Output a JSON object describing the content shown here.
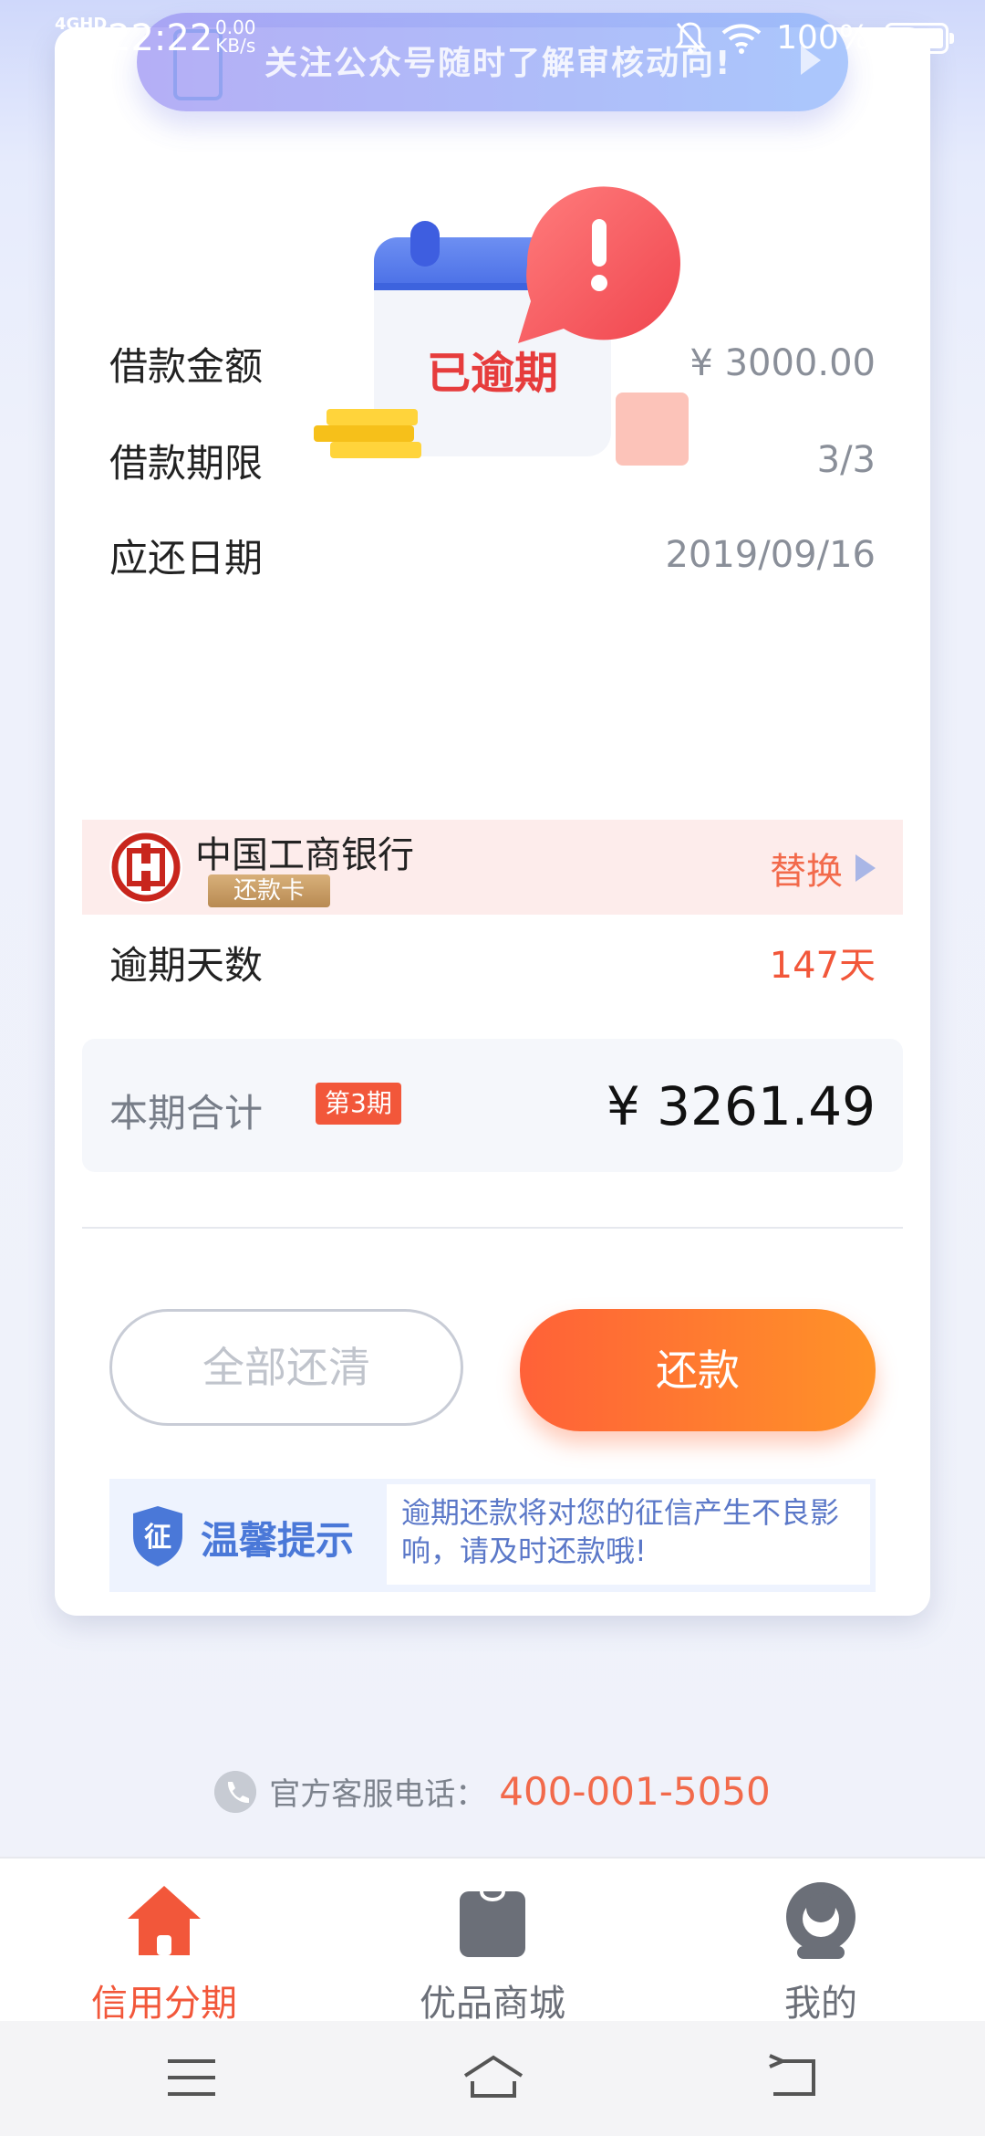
{
  "status_bar": {
    "network": "4GHD",
    "time": "22:22",
    "speed_value": "0.00",
    "speed_unit": "KB/s",
    "battery": "100%"
  },
  "banner": {
    "text": "关注公众号随时了解审核动向!"
  },
  "illustration": {
    "stamp": "已逾期"
  },
  "loan": {
    "rows": [
      {
        "label": "借款金额",
        "value": "¥ 3000.00"
      },
      {
        "label": "借款期限",
        "value": "3/3"
      },
      {
        "label": "应还日期",
        "value": "2019/09/16"
      }
    ],
    "bank": {
      "name": "中国工商银行",
      "tag": "还款卡",
      "action": "替换"
    },
    "overdue": {
      "label": "逾期天数",
      "value": "147天"
    }
  },
  "total": {
    "label": "本期合计",
    "period_badge": "第3期",
    "amount": "¥ 3261.49"
  },
  "buttons": {
    "pay_all": "全部还清",
    "pay": "还款"
  },
  "tip": {
    "title": "温馨提示",
    "message": "逾期还款将对您的征信产生不良影响，请及时还款哦!",
    "shield_char": "征"
  },
  "hotline": {
    "label": "官方客服电话：",
    "number": "400-001-5050"
  },
  "tabs": [
    {
      "label": "信用分期",
      "icon": "home-icon",
      "active": true
    },
    {
      "label": "优品商城",
      "icon": "shopping-bag-icon",
      "active": false
    },
    {
      "label": "我的",
      "icon": "profile-icon",
      "active": false
    }
  ],
  "colors": {
    "accent": "#f2573a",
    "tab_active": "#f2573a",
    "tab_inactive": "#6b6f78",
    "tip_blue": "#4a78d8"
  }
}
